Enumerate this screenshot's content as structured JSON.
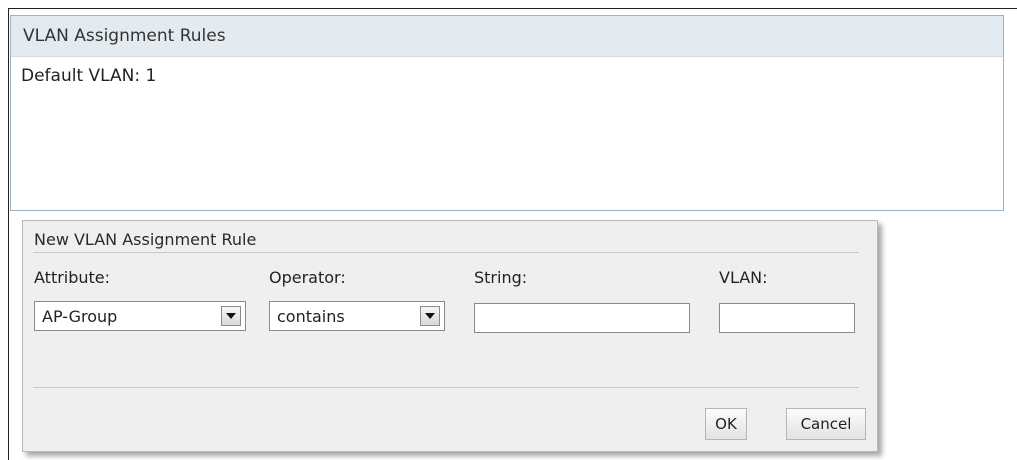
{
  "rules_panel": {
    "title": "VLAN Assignment Rules",
    "default_vlan_text": "Default VLAN: 1"
  },
  "dialog": {
    "title": "New VLAN Assignment Rule",
    "attribute": {
      "label": "Attribute:",
      "selected": "AP-Group",
      "icon": "chevron-down-icon"
    },
    "operator": {
      "label": "Operator:",
      "selected": "contains",
      "icon": "chevron-down-icon"
    },
    "string": {
      "label": "String:",
      "value": ""
    },
    "vlan": {
      "label": "VLAN:",
      "value": ""
    },
    "buttons": {
      "ok": "OK",
      "cancel": "Cancel"
    }
  },
  "colors": {
    "panel_header_bg": "#e4ebf0",
    "panel_border": "#9fb1c4",
    "dialog_bg": "#efefef"
  }
}
